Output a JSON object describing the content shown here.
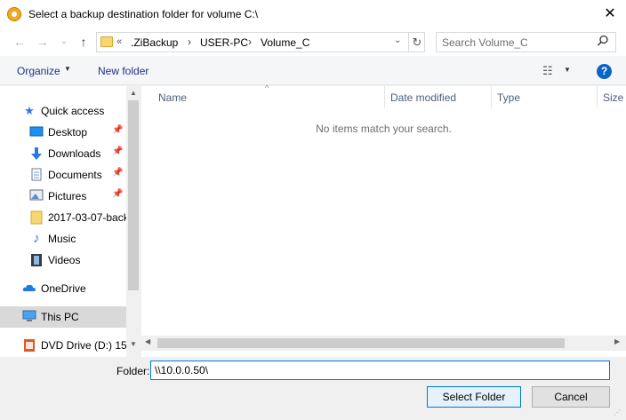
{
  "window": {
    "title": "Select a backup destination folder for volume C:\\",
    "close_glyph": "✕"
  },
  "nav": {
    "back_glyph": "←",
    "forward_glyph": "→",
    "recent_glyph": "⌄",
    "up_glyph": "↑"
  },
  "address": {
    "overflow": "«",
    "crumbs": [
      ".ZiBackup",
      "USER-PC",
      "Volume_C"
    ],
    "separator": "›",
    "dropdown_glyph": "⌄",
    "refresh_glyph": "↻"
  },
  "search": {
    "placeholder": "Search Volume_C",
    "icon": "search-icon"
  },
  "toolbar": {
    "organize_label": "Organize",
    "new_folder_label": "New folder",
    "caret": "▼",
    "view_glyph": "☷",
    "help_glyph": "?"
  },
  "sidebar": {
    "items": [
      {
        "label": "Quick access",
        "icon": "star-icon",
        "pinned": false
      },
      {
        "label": "Desktop",
        "icon": "desktop-icon",
        "pinned": true
      },
      {
        "label": "Downloads",
        "icon": "download-icon",
        "pinned": true
      },
      {
        "label": "Documents",
        "icon": "documents-icon",
        "pinned": true
      },
      {
        "label": "Pictures",
        "icon": "pictures-icon",
        "pinned": true
      },
      {
        "label": "2017-03-07-back",
        "icon": "folder-icon",
        "pinned": false
      },
      {
        "label": "Music",
        "icon": "music-icon",
        "pinned": false
      },
      {
        "label": "Videos",
        "icon": "videos-icon",
        "pinned": false
      },
      {
        "label": "OneDrive",
        "icon": "cloud-icon",
        "pinned": false
      },
      {
        "label": "This PC",
        "icon": "computer-icon",
        "pinned": false,
        "selected": true
      },
      {
        "label": "DVD Drive (D:) 15.",
        "icon": "dvd-drive-icon",
        "pinned": false
      }
    ],
    "pin_glyph": "📌"
  },
  "filelist": {
    "columns": [
      "Name",
      "Date modified",
      "Type",
      "Size"
    ],
    "sort_glyph": "^",
    "empty_message": "No items match your search."
  },
  "footer": {
    "folder_label": "Folder:",
    "folder_value": "\\\\10.0.0.50\\",
    "select_label": "Select Folder",
    "cancel_label": "Cancel"
  },
  "colors": {
    "accent": "#0078d7",
    "link": "#1e3287",
    "selected_bg": "#d9d9d9"
  }
}
